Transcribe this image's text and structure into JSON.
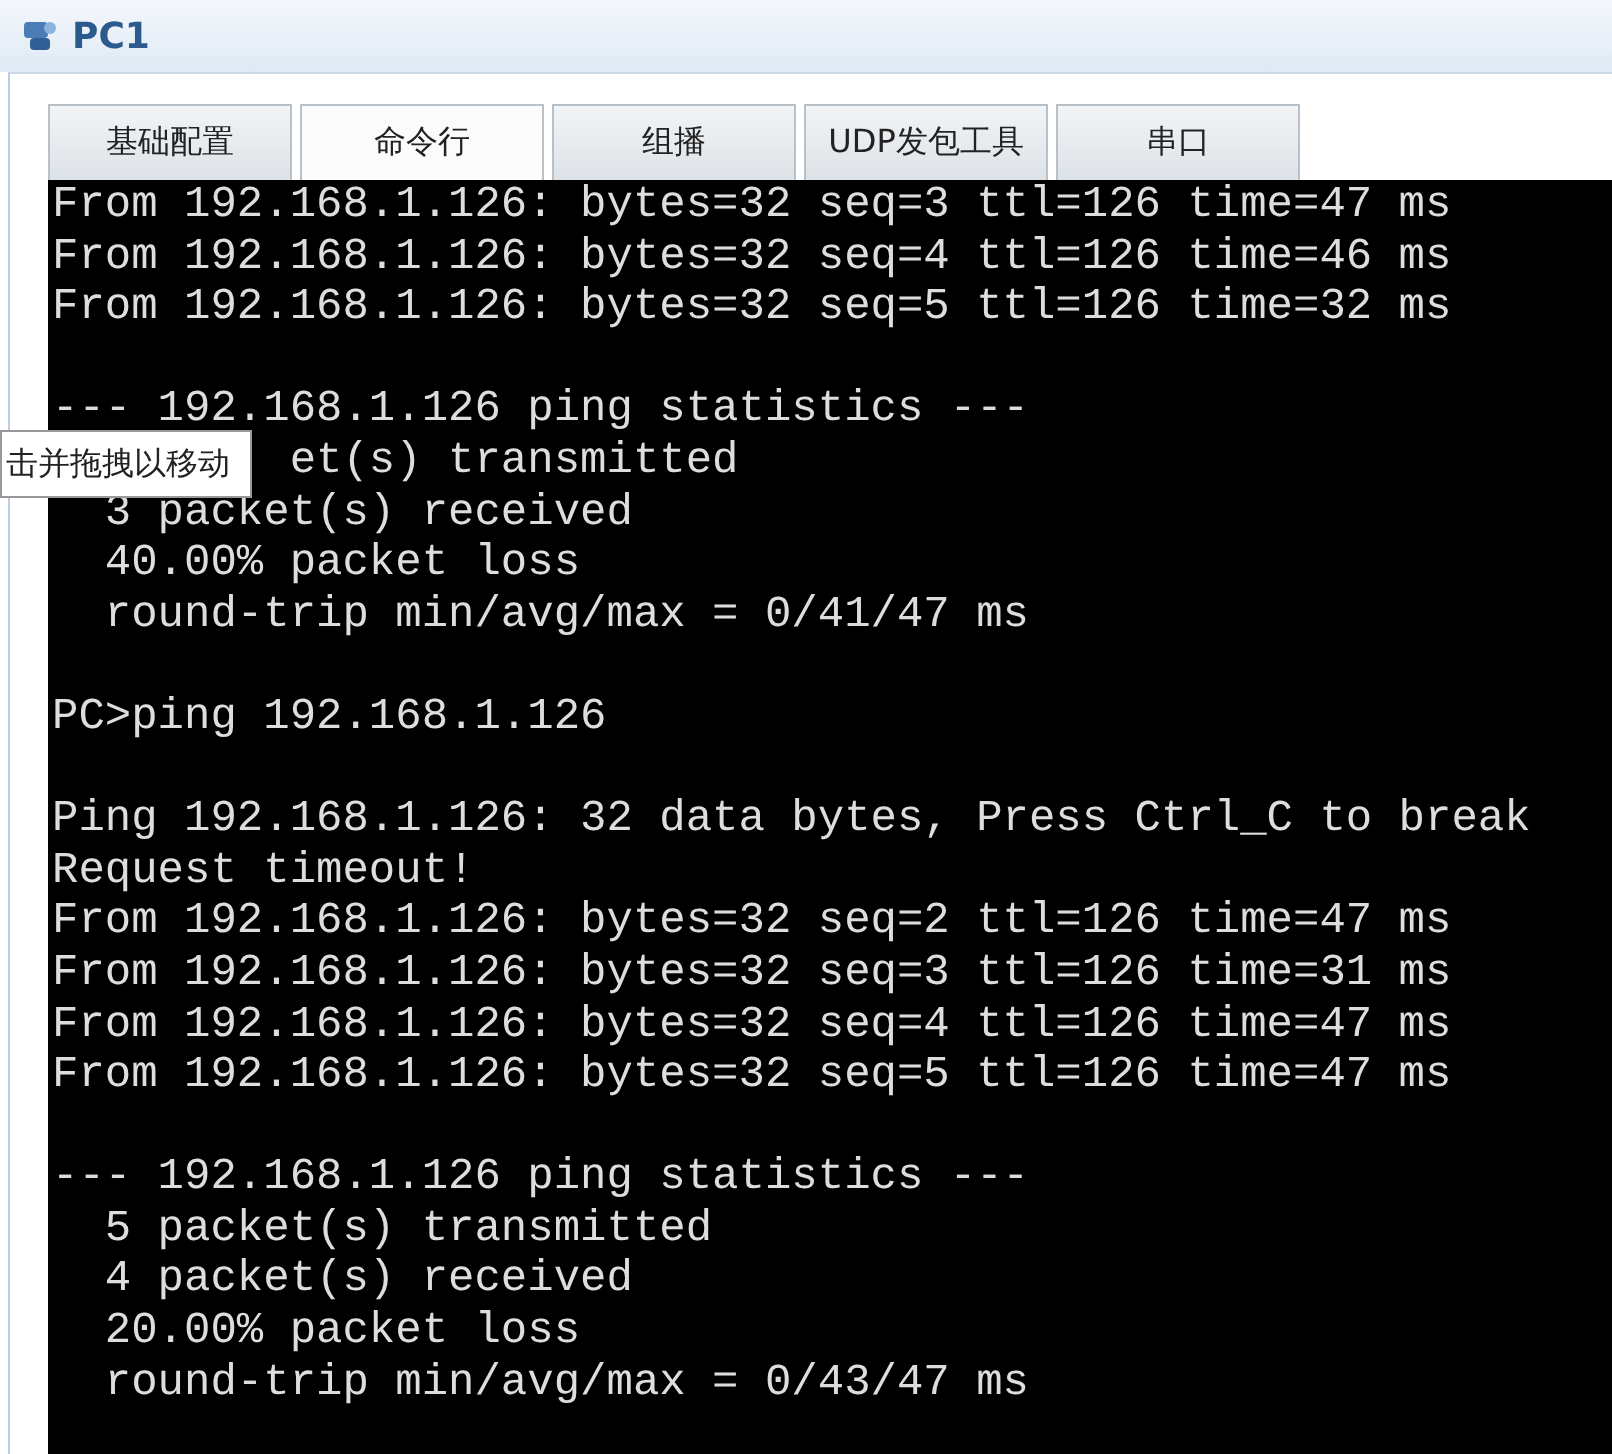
{
  "window": {
    "title": "PC1"
  },
  "tabs": [
    {
      "label": "基础配置",
      "selected": false
    },
    {
      "label": "命令行",
      "selected": true
    },
    {
      "label": "组播",
      "selected": false
    },
    {
      "label": "UDP发包工具",
      "selected": false
    },
    {
      "label": "串口",
      "selected": false
    }
  ],
  "terminal": {
    "lines": [
      {
        "kind": "text",
        "text": "From 192.168.1.126: bytes=32 seq=3 ttl=126 time=47 ms"
      },
      {
        "kind": "text",
        "text": "From 192.168.1.126: bytes=32 seq=4 ttl=126 time=46 ms"
      },
      {
        "kind": "text",
        "text": "From 192.168.1.126: bytes=32 seq=5 ttl=126 time=32 ms"
      },
      {
        "kind": "blank"
      },
      {
        "kind": "text",
        "text": "--- 192.168.1.126 ping statistics ---"
      },
      {
        "kind": "covered",
        "text": "et(s) transmitted"
      },
      {
        "kind": "text",
        "text": "  3 packet(s) received"
      },
      {
        "kind": "text",
        "text": "  40.00% packet loss"
      },
      {
        "kind": "text",
        "text": "  round-trip min/avg/max = 0/41/47 ms"
      },
      {
        "kind": "blank"
      },
      {
        "kind": "text",
        "text": "PC>ping 192.168.1.126"
      },
      {
        "kind": "blank"
      },
      {
        "kind": "text",
        "text": "Ping 192.168.1.126: 32 data bytes, Press Ctrl_C to break"
      },
      {
        "kind": "text",
        "text": "Request timeout!"
      },
      {
        "kind": "text",
        "text": "From 192.168.1.126: bytes=32 seq=2 ttl=126 time=47 ms"
      },
      {
        "kind": "text",
        "text": "From 192.168.1.126: bytes=32 seq=3 ttl=126 time=31 ms"
      },
      {
        "kind": "text",
        "text": "From 192.168.1.126: bytes=32 seq=4 ttl=126 time=47 ms"
      },
      {
        "kind": "text",
        "text": "From 192.168.1.126: bytes=32 seq=5 ttl=126 time=47 ms"
      },
      {
        "kind": "blank"
      },
      {
        "kind": "text",
        "text": "--- 192.168.1.126 ping statistics ---"
      },
      {
        "kind": "text",
        "text": "  5 packet(s) transmitted"
      },
      {
        "kind": "text",
        "text": "  4 packet(s) received"
      },
      {
        "kind": "text",
        "text": "  20.00% packet loss"
      },
      {
        "kind": "text",
        "text": "  round-trip min/avg/max = 0/43/47 ms"
      }
    ]
  },
  "tooltip": {
    "text": "击并拖拽以移动"
  }
}
